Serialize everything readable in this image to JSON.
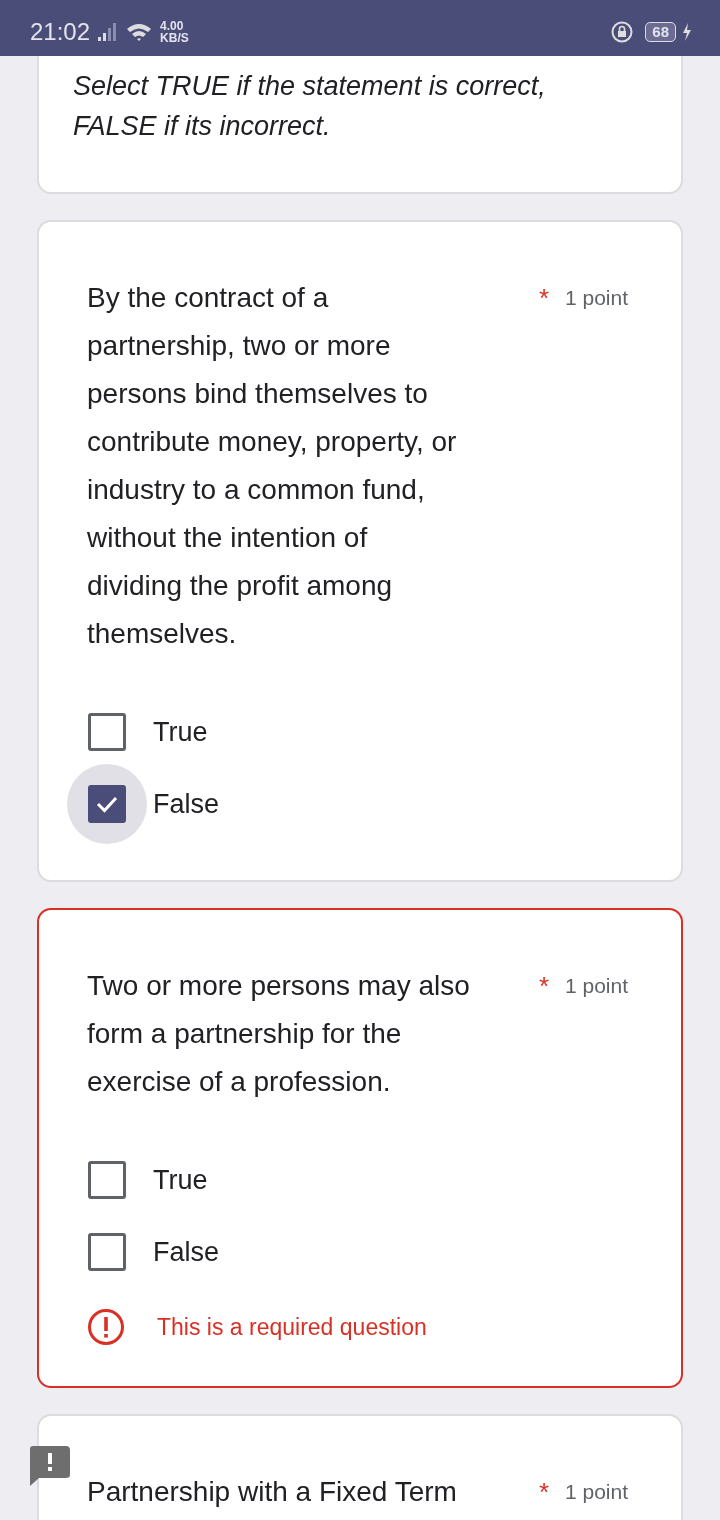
{
  "status_bar": {
    "time": "21:02",
    "speed_value": "4.00",
    "speed_unit": "KB/S",
    "battery": "68"
  },
  "intro": {
    "text": "Select TRUE if the statement is correct,\nFALSE if its incorrect."
  },
  "questions": [
    {
      "text": "By the contract of a\npartnership, two or more\npersons bind themselves to\ncontribute money, property, or\nindustry to a common fund,\nwithout the intention of\ndividing the profit among\nthemselves.",
      "required_mark": "*",
      "points": "1 point",
      "error": false,
      "options": [
        {
          "label": "True",
          "checked": false
        },
        {
          "label": "False",
          "checked": true
        }
      ]
    },
    {
      "text": "Two or more persons may also\nform a partnership for the\nexercise of a profession.",
      "required_mark": "*",
      "points": "1 point",
      "error": true,
      "error_text": "This is a required question",
      "options": [
        {
          "label": "True",
          "checked": false
        },
        {
          "label": "False",
          "checked": false
        }
      ]
    },
    {
      "text": "Partnership with a Fixed Term",
      "required_mark": "*",
      "points": "1 point",
      "error": false,
      "feedback_flag": true
    }
  ]
}
